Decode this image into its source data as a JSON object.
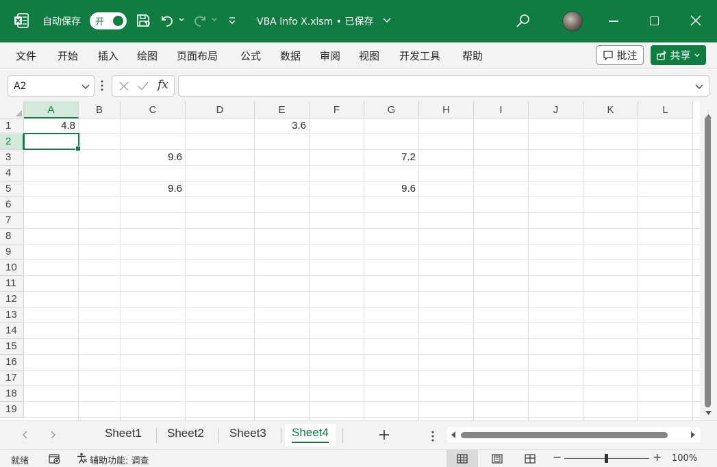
{
  "titlebar": {
    "autosave_label": "自动保存",
    "autosave_state": "开",
    "document_title": "VBA Info X.xlsm • 已保存",
    "brand_color": "#107c41"
  },
  "menu": {
    "items": [
      "文件",
      "开始",
      "插入",
      "绘图",
      "页面布局",
      "公式",
      "数据",
      "审阅",
      "视图",
      "开发工具",
      "帮助"
    ],
    "comment_label": "批注",
    "share_label": "共享"
  },
  "formula_bar": {
    "name_box": "A2",
    "fx_label": "fx",
    "formula": ""
  },
  "sheet": {
    "columns": [
      "A",
      "B",
      "C",
      "D",
      "E",
      "F",
      "G",
      "H",
      "I",
      "J",
      "K",
      "L"
    ],
    "rows": [
      "1",
      "2",
      "3",
      "4",
      "5",
      "6",
      "7",
      "8",
      "9",
      "10",
      "11",
      "12",
      "13",
      "14",
      "15",
      "16",
      "17",
      "18",
      "19"
    ],
    "selected_column": "A",
    "selected_row": "2",
    "cells": [
      {
        "ref": "A1",
        "value": "4.8"
      },
      {
        "ref": "E1",
        "value": "3.6"
      },
      {
        "ref": "C3",
        "value": "9.6"
      },
      {
        "ref": "G3",
        "value": "7.2"
      },
      {
        "ref": "C5",
        "value": "9.6"
      },
      {
        "ref": "G5",
        "value": "9.6"
      }
    ]
  },
  "tabs": {
    "sheets": [
      "Sheet1",
      "Sheet2",
      "Sheet3",
      "Sheet4"
    ],
    "active": "Sheet4",
    "add_label": "+"
  },
  "status": {
    "ready": "就绪",
    "accessibility": "辅助功能: 调查",
    "zoom_minus": "−",
    "zoom_plus": "+",
    "zoom": "100%"
  }
}
